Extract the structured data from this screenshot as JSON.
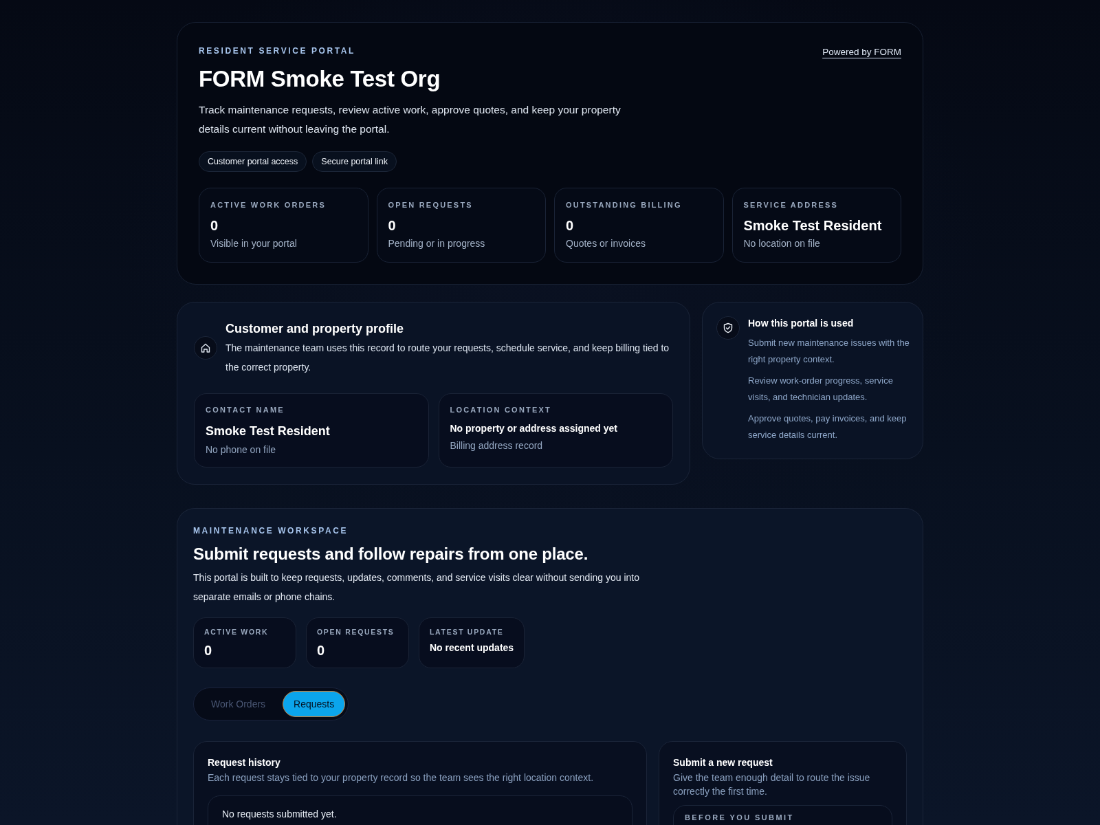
{
  "header": {
    "eyebrow": "RESIDENT SERVICE PORTAL",
    "title": "FORM Smoke Test Org",
    "description": "Track maintenance requests, review active work, approve quotes, and keep your property details current without leaving the portal.",
    "powered_link": "Powered by FORM",
    "pills": [
      "Customer portal access",
      "Secure portal link"
    ],
    "stats": [
      {
        "label": "ACTIVE WORK ORDERS",
        "value": "0",
        "caption": "Visible in your portal"
      },
      {
        "label": "OPEN REQUESTS",
        "value": "0",
        "caption": "Pending or in progress"
      },
      {
        "label": "OUTSTANDING BILLING",
        "value": "0",
        "caption": "Quotes or invoices"
      },
      {
        "label": "SERVICE ADDRESS",
        "value": "Smoke Test Resident",
        "caption": "No location on file"
      }
    ]
  },
  "profile": {
    "title": "Customer and property profile",
    "description": "The maintenance team uses this record to route your requests, schedule service, and keep billing tied to the correct property.",
    "fields": [
      {
        "kind": "large",
        "label": "CONTACT NAME",
        "value": "Smoke Test Resident",
        "caption": "No phone on file"
      },
      {
        "kind": "small",
        "label": "LOCATION CONTEXT",
        "value": "No property or address assigned yet",
        "caption": "Billing address record"
      }
    ]
  },
  "help": {
    "title": "How this portal is used",
    "items": [
      "Submit new maintenance issues with the right property context.",
      "Review work-order progress, service visits, and technician updates.",
      "Approve quotes, pay invoices, and keep service details current."
    ]
  },
  "workspace": {
    "eyebrow": "MAINTENANCE WORKSPACE",
    "title": "Submit requests and follow repairs from one place.",
    "description": "This portal is built to keep requests, updates, comments, and service visits clear without sending you into separate emails or phone chains.",
    "stats": [
      {
        "kind": "number",
        "label": "ACTIVE WORK",
        "value": "0"
      },
      {
        "kind": "number",
        "label": "OPEN REQUESTS",
        "value": "0"
      },
      {
        "kind": "text",
        "label": "LATEST UPDATE",
        "value": "No recent updates"
      }
    ],
    "tabs": [
      {
        "label": "Work Orders",
        "selected": false
      },
      {
        "label": "Requests",
        "selected": true
      }
    ],
    "history": {
      "title": "Request history",
      "description": "Each request stays tied to your property record so the team sees the right location context.",
      "empty_message": "No requests submitted yet."
    },
    "submit": {
      "title": "Submit a new request",
      "description": "Give the team enough detail to route the issue correctly the first time.",
      "section_label": "BEFORE YOU SUBMIT"
    }
  }
}
